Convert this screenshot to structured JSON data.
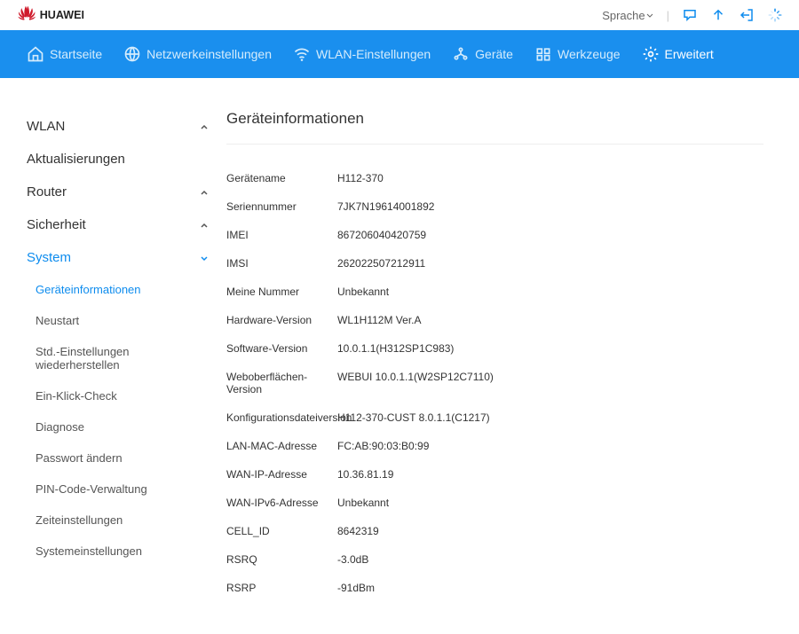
{
  "header": {
    "brand": "HUAWEI",
    "language_label": "Sprache"
  },
  "nav": {
    "items": [
      {
        "label": "Startseite"
      },
      {
        "label": "Netzwerkeinstellungen"
      },
      {
        "label": "WLAN-Einstellungen"
      },
      {
        "label": "Geräte"
      },
      {
        "label": "Werkzeuge"
      },
      {
        "label": "Erweitert"
      }
    ]
  },
  "sidebar": {
    "groups": [
      {
        "label": "WLAN"
      },
      {
        "label": "Aktualisierungen"
      },
      {
        "label": "Router"
      },
      {
        "label": "Sicherheit"
      },
      {
        "label": "System"
      }
    ],
    "subs": [
      {
        "label": "Geräteinformationen"
      },
      {
        "label": "Neustart"
      },
      {
        "label": "Std.-Einstellungen wiederherstellen"
      },
      {
        "label": "Ein-Klick-Check"
      },
      {
        "label": "Diagnose"
      },
      {
        "label": "Passwort ändern"
      },
      {
        "label": "PIN-Code-Verwaltung"
      },
      {
        "label": "Zeiteinstellungen"
      },
      {
        "label": "Systemeinstellungen"
      }
    ]
  },
  "page": {
    "title": "Geräteinformationen",
    "rows": [
      {
        "label": "Gerätename",
        "value": "H112-370"
      },
      {
        "label": "Seriennummer",
        "value": "7JK7N19614001892"
      },
      {
        "label": "IMEI",
        "value": "867206040420759"
      },
      {
        "label": "IMSI",
        "value": "262022507212911"
      },
      {
        "label": "Meine Nummer",
        "value": "Unbekannt"
      },
      {
        "label": "Hardware-Version",
        "value": "WL1H112M Ver.A"
      },
      {
        "label": "Software-Version",
        "value": "10.0.1.1(H312SP1C983)"
      },
      {
        "label": "Weboberflächen-Version",
        "value": "WEBUI 10.0.1.1(W2SP12C7110)"
      },
      {
        "label": "Konfigurationsdateiversion",
        "value": "H112-370-CUST 8.0.1.1(C1217)"
      },
      {
        "label": "LAN-MAC-Adresse",
        "value": "FC:AB:90:03:B0:99"
      },
      {
        "label": "WAN-IP-Adresse",
        "value": "10.36.81.19"
      },
      {
        "label": "WAN-IPv6-Adresse",
        "value": "Unbekannt"
      },
      {
        "label": "CELL_ID",
        "value": "8642319"
      },
      {
        "label": "RSRQ",
        "value": "-3.0dB"
      },
      {
        "label": "RSRP",
        "value": "-91dBm"
      }
    ]
  }
}
